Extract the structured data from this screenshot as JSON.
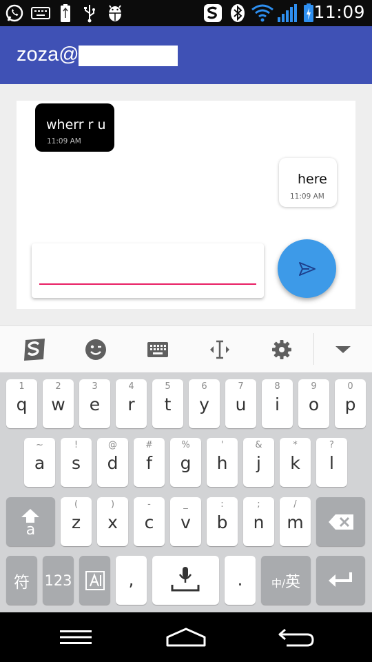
{
  "status_bar": {
    "time": "11:09",
    "icons": [
      "whatsapp-icon",
      "keyboard-icon",
      "usb-battery-icon",
      "usb-icon",
      "android-debug-icon",
      "sogou-icon",
      "bluetooth-icon",
      "wifi-icon",
      "signal-icon",
      "battery-charging-icon"
    ]
  },
  "app_bar": {
    "title": "zoza@"
  },
  "messages": [
    {
      "direction": "incoming",
      "text": "wherr r u",
      "time": "11:09 AM"
    },
    {
      "direction": "outgoing",
      "text": "here",
      "time": "11:09 AM"
    }
  ],
  "composer": {
    "value": "",
    "placeholder": "",
    "send_icon": "send-icon"
  },
  "colors": {
    "app_bar": "#3f51b5",
    "fab": "#3d9ae8",
    "input_underline": "#e91e63",
    "incoming_bubble": "#000000",
    "outgoing_bubble": "#ffffff"
  },
  "keyboard_toolbar": {
    "items": [
      "sogou-logo-icon",
      "emoji-icon",
      "keyboard-icon",
      "cursor-move-icon",
      "gear-icon",
      "chevron-down-icon"
    ]
  },
  "keyboard": {
    "row1": [
      {
        "hint": "1",
        "key": "q"
      },
      {
        "hint": "2",
        "key": "w"
      },
      {
        "hint": "3",
        "key": "e"
      },
      {
        "hint": "4",
        "key": "r"
      },
      {
        "hint": "5",
        "key": "t"
      },
      {
        "hint": "6",
        "key": "y"
      },
      {
        "hint": "7",
        "key": "u"
      },
      {
        "hint": "8",
        "key": "i"
      },
      {
        "hint": "9",
        "key": "o"
      },
      {
        "hint": "0",
        "key": "p"
      }
    ],
    "row2": [
      {
        "hint": "~",
        "key": "a"
      },
      {
        "hint": "!",
        "key": "s"
      },
      {
        "hint": "@",
        "key": "d"
      },
      {
        "hint": "#",
        "key": "f"
      },
      {
        "hint": "%",
        "key": "g"
      },
      {
        "hint": "'",
        "key": "h"
      },
      {
        "hint": "&",
        "key": "j"
      },
      {
        "hint": "*",
        "key": "k"
      },
      {
        "hint": "?",
        "key": "l"
      }
    ],
    "row3": [
      {
        "hint": "(",
        "key": "z"
      },
      {
        "hint": ")",
        "key": "x"
      },
      {
        "hint": "-",
        "key": "c"
      },
      {
        "hint": "_",
        "key": "v"
      },
      {
        "hint": ":",
        "key": "b"
      },
      {
        "hint": ";",
        "key": "n"
      },
      {
        "hint": "/",
        "key": "m"
      }
    ],
    "shift_label": "a",
    "symbols_label": "符",
    "numbers_label": "123",
    "comma_label": ",",
    "period_label": ".",
    "lang_label_small": "中",
    "lang_label_sep": "/",
    "lang_label_big": "英"
  },
  "nav_bar": {
    "items": [
      "menu-icon",
      "home-icon",
      "back-icon"
    ]
  }
}
